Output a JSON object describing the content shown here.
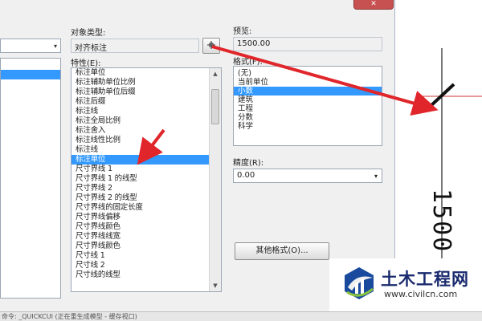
{
  "window": {
    "close_label": "✕"
  },
  "left_panel": {
    "combo_arrow": "▾"
  },
  "object_type": {
    "label": "对象类型:",
    "value": "对齐标注",
    "pick_button_icon": "pick-cursor-icon"
  },
  "properties": {
    "label": "特性(E):",
    "items": [
      "标注单位",
      "标注辅助单位比例",
      "标注辅助单位后缀",
      "标注后缀",
      "标注线",
      "标注全局比例",
      "标注舍入",
      "标注线性比例",
      "标注线",
      "标注单位",
      "尺寸界线 1",
      "尺寸界线 1 的线型",
      "尺寸界线 2",
      "尺寸界线 2 的线型",
      "尺寸界线的固定长度",
      "尺寸界线偏移",
      "尺寸界线颜色",
      "尺寸界线线宽",
      "尺寸界线颜色",
      "尺寸线 1",
      "尺寸线 2",
      "尺寸线的线型"
    ],
    "selected_index": 9
  },
  "preview": {
    "label": "预览:",
    "value": "1500.00"
  },
  "format": {
    "label": "格式(F):",
    "items": [
      "(无)",
      "当前单位",
      "小数",
      "建筑",
      "工程",
      "分数",
      "科学"
    ],
    "selected_index": 2
  },
  "precision": {
    "label": "精度(R):",
    "value": "0.00",
    "arrow": "▾"
  },
  "other_format_button": "其他格式(O)...",
  "status_bar": "命令: _QUICKCUI  (正在重生成模型 - 缓存视口)",
  "drawing": {
    "dimension_text": "1500"
  },
  "watermark": {
    "title": "土木工程网",
    "url": "www.civilcn.com"
  },
  "colors": {
    "selection": "#3399ff",
    "annotation_arrow": "#e0262a",
    "watermark_blue": "#1a2a6e"
  }
}
